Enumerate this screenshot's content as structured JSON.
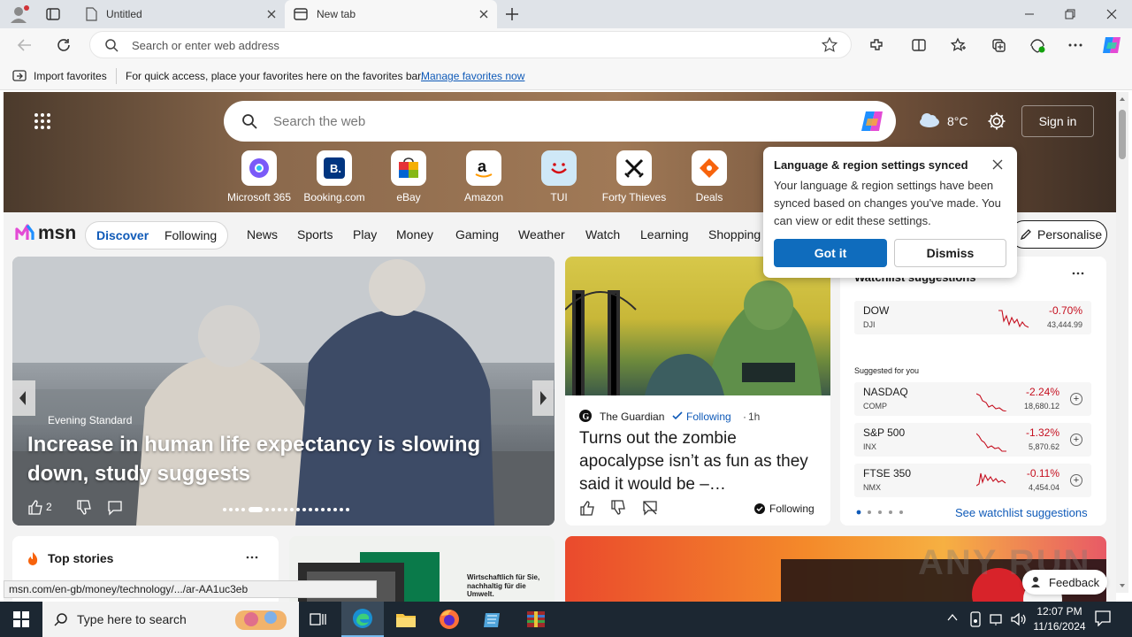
{
  "tabs": [
    {
      "title": "Untitled"
    },
    {
      "title": "New tab"
    }
  ],
  "address": {
    "placeholder": "Search or enter web address"
  },
  "favorites_bar": {
    "import": "Import favorites",
    "hint": "For quick access, place your favorites here on the favorites bar.",
    "link": "Manage favorites now"
  },
  "hero": {
    "search_placeholder": "Search the web",
    "weather": "8°C",
    "sign_in": "Sign in",
    "quick_links": [
      {
        "label": "Microsoft 365"
      },
      {
        "label": "Booking.com"
      },
      {
        "label": "eBay"
      },
      {
        "label": "Amazon"
      },
      {
        "label": "TUI"
      },
      {
        "label": "Forty Thieves"
      },
      {
        "label": "Deals"
      }
    ]
  },
  "nav": {
    "brand": "msn",
    "discover": "Discover",
    "following": "Following",
    "items": [
      "News",
      "Sports",
      "Play",
      "Money",
      "Gaming",
      "Weather",
      "Watch",
      "Learning",
      "Shopping"
    ],
    "personalise": "Personalise"
  },
  "main_story": {
    "source": "Evening Standard",
    "headline": "Increase in human life expectancy is slowing down, study suggests",
    "likes": "2"
  },
  "zombie_story": {
    "source": "The Guardian",
    "follow": "Following",
    "age": "1h",
    "headline": "Turns out the zombie apocalypse isn’t as fun as they said it would be –…",
    "following_label": "Following"
  },
  "watchlist": {
    "title": "Watchlist suggestions",
    "main": {
      "sym": "DOW",
      "exch": "DJI",
      "change": "-0.70%",
      "value": "43,444.99"
    },
    "suggested_label": "Suggested for you",
    "rows": [
      {
        "sym": "NASDAQ",
        "exch": "COMP",
        "change": "-2.24%",
        "value": "18,680.12"
      },
      {
        "sym": "S&P 500",
        "exch": "INX",
        "change": "-1.32%",
        "value": "5,870.62"
      },
      {
        "sym": "FTSE 350",
        "exch": "NMX",
        "change": "-0.11%",
        "value": "4,454.04"
      }
    ],
    "see_more": "See watchlist suggestions"
  },
  "top_stories": {
    "title": "Top stories"
  },
  "ad": {
    "line1": "Wirtschaftlich für Sie,",
    "line2": "nachhaltig für die Umwelt."
  },
  "popup": {
    "title": "Language & region settings synced",
    "body": "Your language & region settings have been synced based on changes you've made. You can view or edit these settings.",
    "got_it": "Got it",
    "dismiss": "Dismiss"
  },
  "status_url": "msn.com/en-gb/money/technology/.../ar-AA1uc3eb",
  "feedback": "Feedback",
  "watermark": "ANY RUN",
  "taskbar": {
    "search_placeholder": "Type here to search",
    "time": "12:07 PM",
    "date": "11/16/2024"
  }
}
